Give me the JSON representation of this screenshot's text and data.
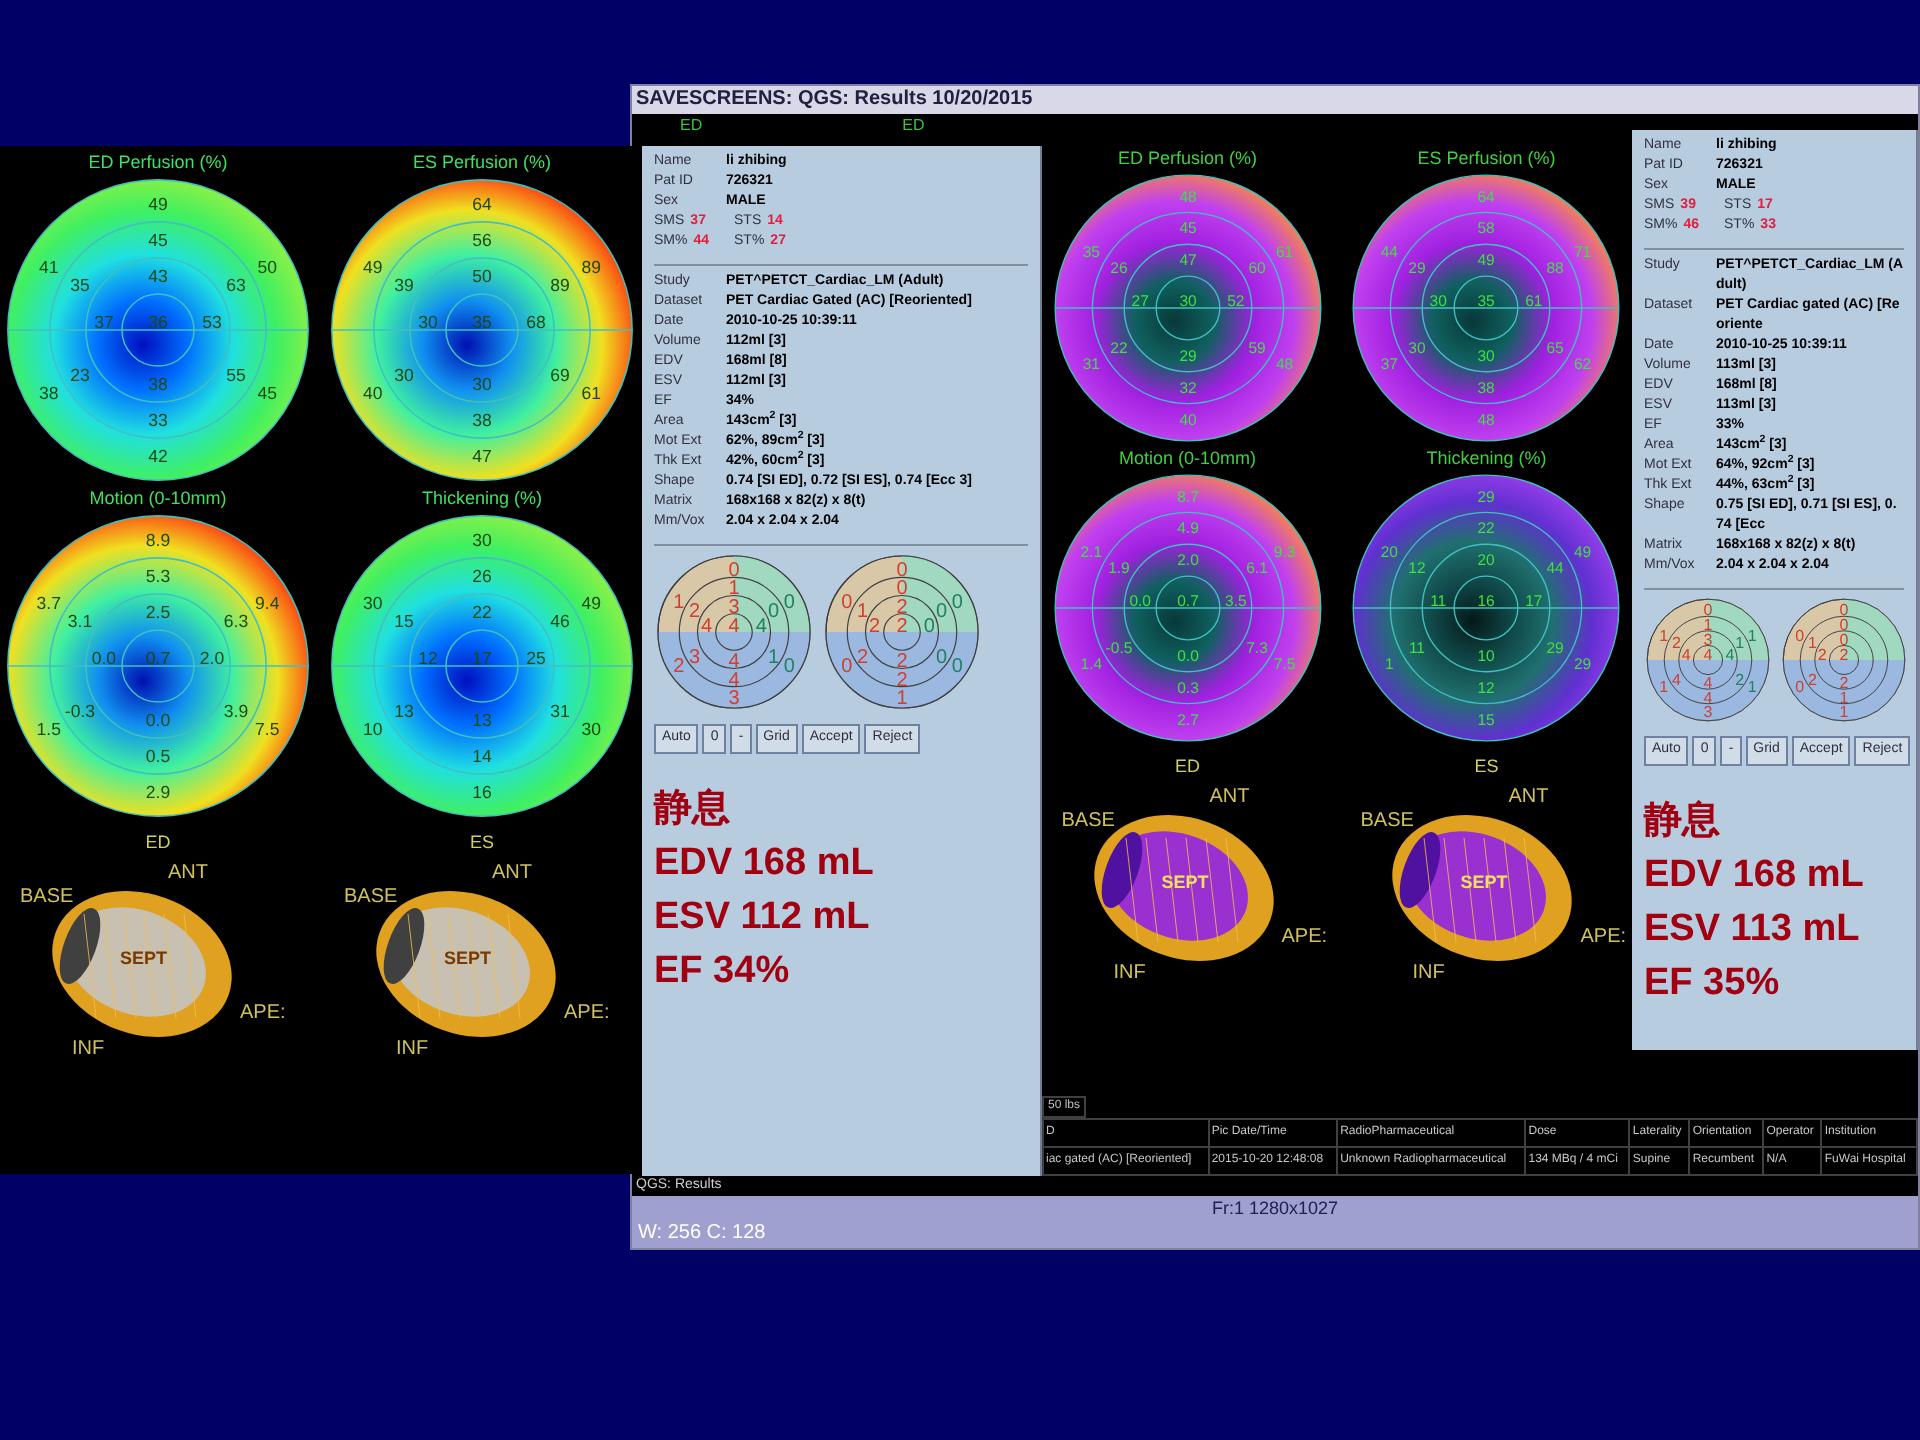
{
  "left_panel": {
    "maps": [
      {
        "title": "ED Perfusion (%)",
        "segments": {
          "b_ant": "49",
          "m_ant": "45",
          "b_as": "41",
          "b_al": "50",
          "m_as": "35",
          "a_ant": "43",
          "m_al": "63",
          "a_sep": "37",
          "apex": "36",
          "a_lat": "53",
          "m_is": "23",
          "m_il": "55",
          "b_is": "38",
          "a_inf": "38",
          "b_il": "45",
          "m_inf": "33",
          "b_inf": "42"
        }
      },
      {
        "title": "ES Perfusion (%)",
        "segments": {
          "b_ant": "64",
          "m_ant": "56",
          "b_as": "49",
          "b_al": "89",
          "m_as": "39",
          "a_ant": "50",
          "m_al": "89",
          "a_sep": "30",
          "apex": "35",
          "a_lat": "68",
          "m_is": "30",
          "m_il": "69",
          "b_is": "40",
          "a_inf": "30",
          "b_il": "61",
          "m_inf": "38",
          "b_inf": "47"
        }
      },
      {
        "title": "Motion (0-10mm)",
        "segments": {
          "b_ant": "8.9",
          "m_ant": "5.3",
          "b_as": "3.7",
          "b_al": "9.4",
          "m_as": "3.1",
          "a_ant": "2.5",
          "m_al": "6.3",
          "a_sep": "0.0",
          "apex": "0.7",
          "a_lat": "2.0",
          "m_is": "-0.3",
          "m_il": "3.9",
          "b_is": "1.5",
          "a_inf": "0.0",
          "b_il": "7.5",
          "m_inf": "0.5",
          "b_inf": "2.9"
        }
      },
      {
        "title": "Thickening (%)",
        "segments": {
          "b_ant": "30",
          "m_ant": "26",
          "b_as": "30",
          "b_al": "49",
          "m_as": "15",
          "a_ant": "22",
          "m_al": "46",
          "a_sep": "12",
          "apex": "17",
          "a_lat": "25",
          "m_is": "13",
          "m_il": "31",
          "b_is": "10",
          "a_inf": "13",
          "b_il": "30",
          "m_inf": "14",
          "b_inf": "16"
        }
      }
    ],
    "phase_labels": [
      "ED",
      "ES"
    ],
    "hearts": [
      {
        "base": "BASE",
        "ant": "ANT",
        "apex": "APE:",
        "inf": "INF",
        "center": "SEPT"
      },
      {
        "base": "BASE",
        "ant": "ANT",
        "apex": "APE:",
        "inf": "INF",
        "center": "SEPT"
      }
    ]
  },
  "window": {
    "title": "SAVESCREENS: QGS: Results 10/20/2015",
    "top_labels": [
      "ED",
      "ED"
    ],
    "info_panels": [
      {
        "patient": [
          {
            "label": "Name",
            "value": "li zhibing"
          },
          {
            "label": "Pat ID",
            "value": "726321"
          },
          {
            "label": "Sex",
            "value": "MALE"
          }
        ],
        "scores": [
          [
            {
              "label": "SMS",
              "value": "37"
            },
            {
              "label": "STS",
              "value": "14"
            }
          ],
          [
            {
              "label": "SM%",
              "value": "44"
            },
            {
              "label": "ST%",
              "value": "27"
            }
          ]
        ],
        "study": [
          {
            "label": "Study",
            "value": "PET^PETCT_Cardiac_LM (Adult)"
          },
          {
            "label": "Dataset",
            "value": "PET Cardiac Gated (AC) [Reoriented]"
          },
          {
            "label": "Date",
            "value": "2010-10-25 10:39:11"
          },
          {
            "label": "Volume",
            "value": "112ml [3]"
          },
          {
            "label": "EDV",
            "value": "168ml [8]"
          },
          {
            "label": "ESV",
            "value": "112ml [3]"
          },
          {
            "label": "EF",
            "value": "34%"
          },
          {
            "label": "Area",
            "value": "143cm$^{2}$ [3]"
          },
          {
            "label": "Mot Ext",
            "value": "62%, 89cm$^{2}$ [3]"
          },
          {
            "label": "Thk Ext",
            "value": "42%, 60cm$^{2}$ [3]"
          },
          {
            "label": "Shape",
            "value": "0.74 [SI ED], 0.72 [SI ES], 0.74 [Ecc 3]"
          },
          {
            "label": "Matrix",
            "value": "168x168 x 82(z) x 8(t)"
          },
          {
            "label": "Mm/Vox",
            "value": "2.04 x 2.04 x 2.04"
          }
        ],
        "bullseyes": [
          {
            "b_ant": "0",
            "m_ant": "1",
            "b_as": "1",
            "b_al": "0",
            "m_as": "2",
            "a_ant": "3",
            "m_al": "0",
            "a_sep": "4",
            "apex": "4",
            "a_lat": "4",
            "m_is": "3",
            "m_il": "1",
            "b_is": "2",
            "a_inf": "4",
            "b_il": "0",
            "m_inf": "4",
            "b_inf": "3"
          },
          {
            "b_ant": "0",
            "m_ant": "0",
            "b_as": "0",
            "b_al": "0",
            "m_as": "1",
            "a_ant": "2",
            "m_al": "0",
            "a_sep": "2",
            "apex": "2",
            "a_lat": "0",
            "m_is": "2",
            "m_il": "0",
            "b_is": "0",
            "a_inf": "2",
            "b_il": "0",
            "m_inf": "2",
            "b_inf": "1"
          }
        ],
        "buttons": [
          "Auto",
          "0",
          "-",
          "Grid",
          "Accept",
          "Reject"
        ],
        "summary": [
          "静息",
          "EDV 168 mL",
          "ESV 112 mL",
          "EF 34%"
        ]
      },
      {
        "patient": [
          {
            "label": "Name",
            "value": "li zhibing"
          },
          {
            "label": "Pat ID",
            "value": "726321"
          },
          {
            "label": "Sex",
            "value": "MALE"
          }
        ],
        "scores": [
          [
            {
              "label": "SMS",
              "value": "39"
            },
            {
              "label": "STS",
              "value": "17"
            }
          ],
          [
            {
              "label": "SM%",
              "value": "46"
            },
            {
              "label": "ST%",
              "value": "33"
            }
          ]
        ],
        "study": [
          {
            "label": "Study",
            "value": "PET^PETCT_Cardiac_LM (Adult)"
          },
          {
            "label": "Dataset",
            "value": "PET Cardiac gated (AC) [Reoriente"
          },
          {
            "label": "Date",
            "value": "2010-10-25 10:39:11"
          },
          {
            "label": "Volume",
            "value": "113ml [3]"
          },
          {
            "label": "EDV",
            "value": "168ml [8]"
          },
          {
            "label": "ESV",
            "value": "113ml [3]"
          },
          {
            "label": "EF",
            "value": "33%"
          },
          {
            "label": "Area",
            "value": "143cm$^{2}$ [3]"
          },
          {
            "label": "Mot Ext",
            "value": "64%, 92cm$^{2}$ [3]"
          },
          {
            "label": "Thk Ext",
            "value": "44%, 63cm$^{2}$ [3]"
          },
          {
            "label": "Shape",
            "value": "0.75 [SI ED], 0.71 [SI ES], 0.74 [Ecc"
          },
          {
            "label": "Matrix",
            "value": "168x168 x 82(z) x 8(t)"
          },
          {
            "label": "Mm/Vox",
            "value": "2.04 x 2.04 x 2.04"
          }
        ],
        "bullseyes": [
          {
            "b_ant": "0",
            "m_ant": "1",
            "b_as": "1",
            "b_al": "1",
            "m_as": "2",
            "a_ant": "3",
            "m_al": "1",
            "a_sep": "4",
            "apex": "4",
            "a_lat": "4",
            "m_is": "4",
            "m_il": "2",
            "b_is": "1",
            "a_inf": "4",
            "b_il": "1",
            "m_inf": "4",
            "b_inf": "3"
          },
          {
            "b_ant": "0",
            "m_ant": "0",
            "b_as": "0",
            "m_as": "1",
            "a_ant": "0",
            "a_sep": "2",
            "apex": "2",
            "m_is": "2",
            "b_is": "0",
            "a_inf": "2",
            "m_inf": "1",
            "b_inf": "1"
          }
        ],
        "buttons": [
          "Auto",
          "0",
          "-",
          "Grid",
          "Accept",
          "Reject"
        ],
        "summary": [
          "静息",
          "EDV 168 mL",
          "ESV 113 mL",
          "EF 35%"
        ]
      }
    ],
    "maps": [
      {
        "title": "ED Perfusion (%)",
        "segments": {
          "b_ant": "48",
          "m_ant": "45",
          "b_as": "35",
          "b_al": "61",
          "m_as": "26",
          "a_ant": "47",
          "m_al": "60",
          "a_sep": "27",
          "apex": "30",
          "a_lat": "52",
          "m_is": "22",
          "m_il": "59",
          "b_is": "31",
          "a_inf": "29",
          "b_il": "48",
          "m_inf": "32",
          "b_inf": "40"
        }
      },
      {
        "title": "ES Perfusion (%)",
        "segments": {
          "b_ant": "64",
          "m_ant": "58",
          "b_as": "44",
          "b_al": "71",
          "m_as": "29",
          "a_ant": "49",
          "m_al": "88",
          "a_sep": "30",
          "apex": "35",
          "a_lat": "61",
          "m_is": "30",
          "m_il": "65",
          "b_is": "37",
          "a_inf": "30",
          "b_il": "62",
          "m_inf": "38",
          "b_inf": "48"
        }
      },
      {
        "title": "Motion (0-10mm)",
        "segments": {
          "b_ant": "8.7",
          "m_ant": "4.9",
          "b_as": "2.1",
          "b_al": "9.3",
          "m_as": "1.9",
          "a_ant": "2.0",
          "m_al": "6.1",
          "a_sep": "0.0",
          "apex": "0.7",
          "a_lat": "3.5",
          "m_is": "-0.5",
          "m_il": "7.3",
          "b_is": "1.4",
          "a_inf": "0.0",
          "b_il": "7.5",
          "m_inf": "0.3",
          "b_inf": "2.7"
        }
      },
      {
        "title": "Thickening (%)",
        "segments": {
          "b_ant": "29",
          "m_ant": "22",
          "b_as": "20",
          "b_al": "49",
          "m_as": "12",
          "a_ant": "20",
          "m_al": "44",
          "a_sep": "11",
          "apex": "16",
          "a_lat": "17",
          "m_is": "11",
          "m_il": "29",
          "b_is": "1",
          "a_inf": "10",
          "b_il": "29",
          "m_inf": "12",
          "b_inf": "15"
        }
      }
    ],
    "phase_labels": [
      "ED",
      "ES"
    ],
    "hearts": [
      {
        "base": "BASE",
        "ant": "ANT",
        "apex": "APE:",
        "inf": "INF",
        "center": "SEPT"
      },
      {
        "base": "BASE",
        "ant": "ANT",
        "apex": "APE:",
        "inf": "INF",
        "center": "SEPT"
      }
    ],
    "weight_fragment": "50 lbs",
    "table": {
      "columns": [
        "D",
        "Pic Date/Time",
        "RadioPharmaceutical",
        "Dose",
        "Laterality",
        "Orientation",
        "Operator",
        "Institution"
      ],
      "rows": [
        [
          "iac gated (AC) [Reoriented]",
          "2015-10-20 12:48:08",
          "Unknown Radiopharmaceutical",
          "134 MBq / 4 mCi",
          "Supine",
          "Recumbent",
          "N/A",
          "FuWai Hospital"
        ]
      ]
    },
    "footer_label": "QGS: Results",
    "status_bar": {
      "frame": "Fr:1 1280x1027",
      "window_level": "W: 256  C: 128"
    }
  }
}
